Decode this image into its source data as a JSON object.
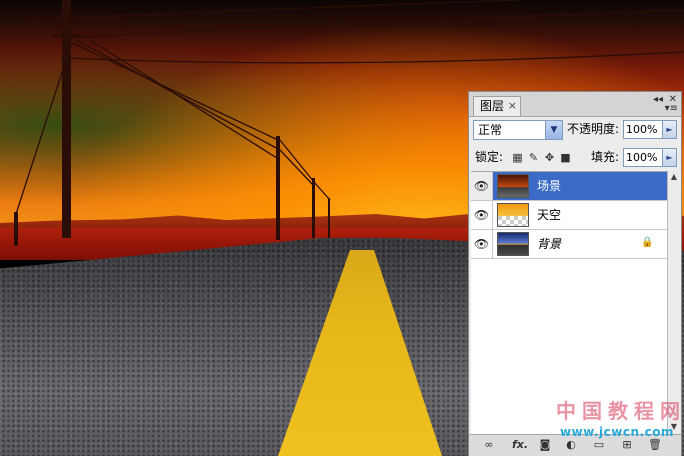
{
  "panel": {
    "tab_label": "图层",
    "tab_close": "×",
    "minimize": "◂◂",
    "close": "✕",
    "menu": "▾≡",
    "blend_mode": "正常",
    "opacity_label": "不透明度:",
    "opacity_value": "100%",
    "lock_label": "锁定:",
    "fill_label": "填充:",
    "fill_value": "100%",
    "layers": [
      {
        "name": "场景",
        "selected": true,
        "visible": true,
        "thumbnail": "scene",
        "locked": false
      },
      {
        "name": "天空",
        "selected": false,
        "visible": true,
        "thumbnail": "sky-transparent",
        "locked": false
      },
      {
        "name": "背景",
        "selected": false,
        "visible": true,
        "thumbnail": "background",
        "locked": true
      }
    ],
    "bottom_icons": [
      "link-icon",
      "fx-icon",
      "mask-icon",
      "adjustment-icon",
      "group-icon",
      "new-layer-icon",
      "trash-icon"
    ],
    "fx_label": "fx."
  },
  "watermark": {
    "text_cn": "中国教程网",
    "url": "www.jcwcn.com"
  },
  "colors": {
    "selection": "#3b6bc7",
    "panel_bg": "#ececec",
    "stripe": "#e8b81a"
  }
}
